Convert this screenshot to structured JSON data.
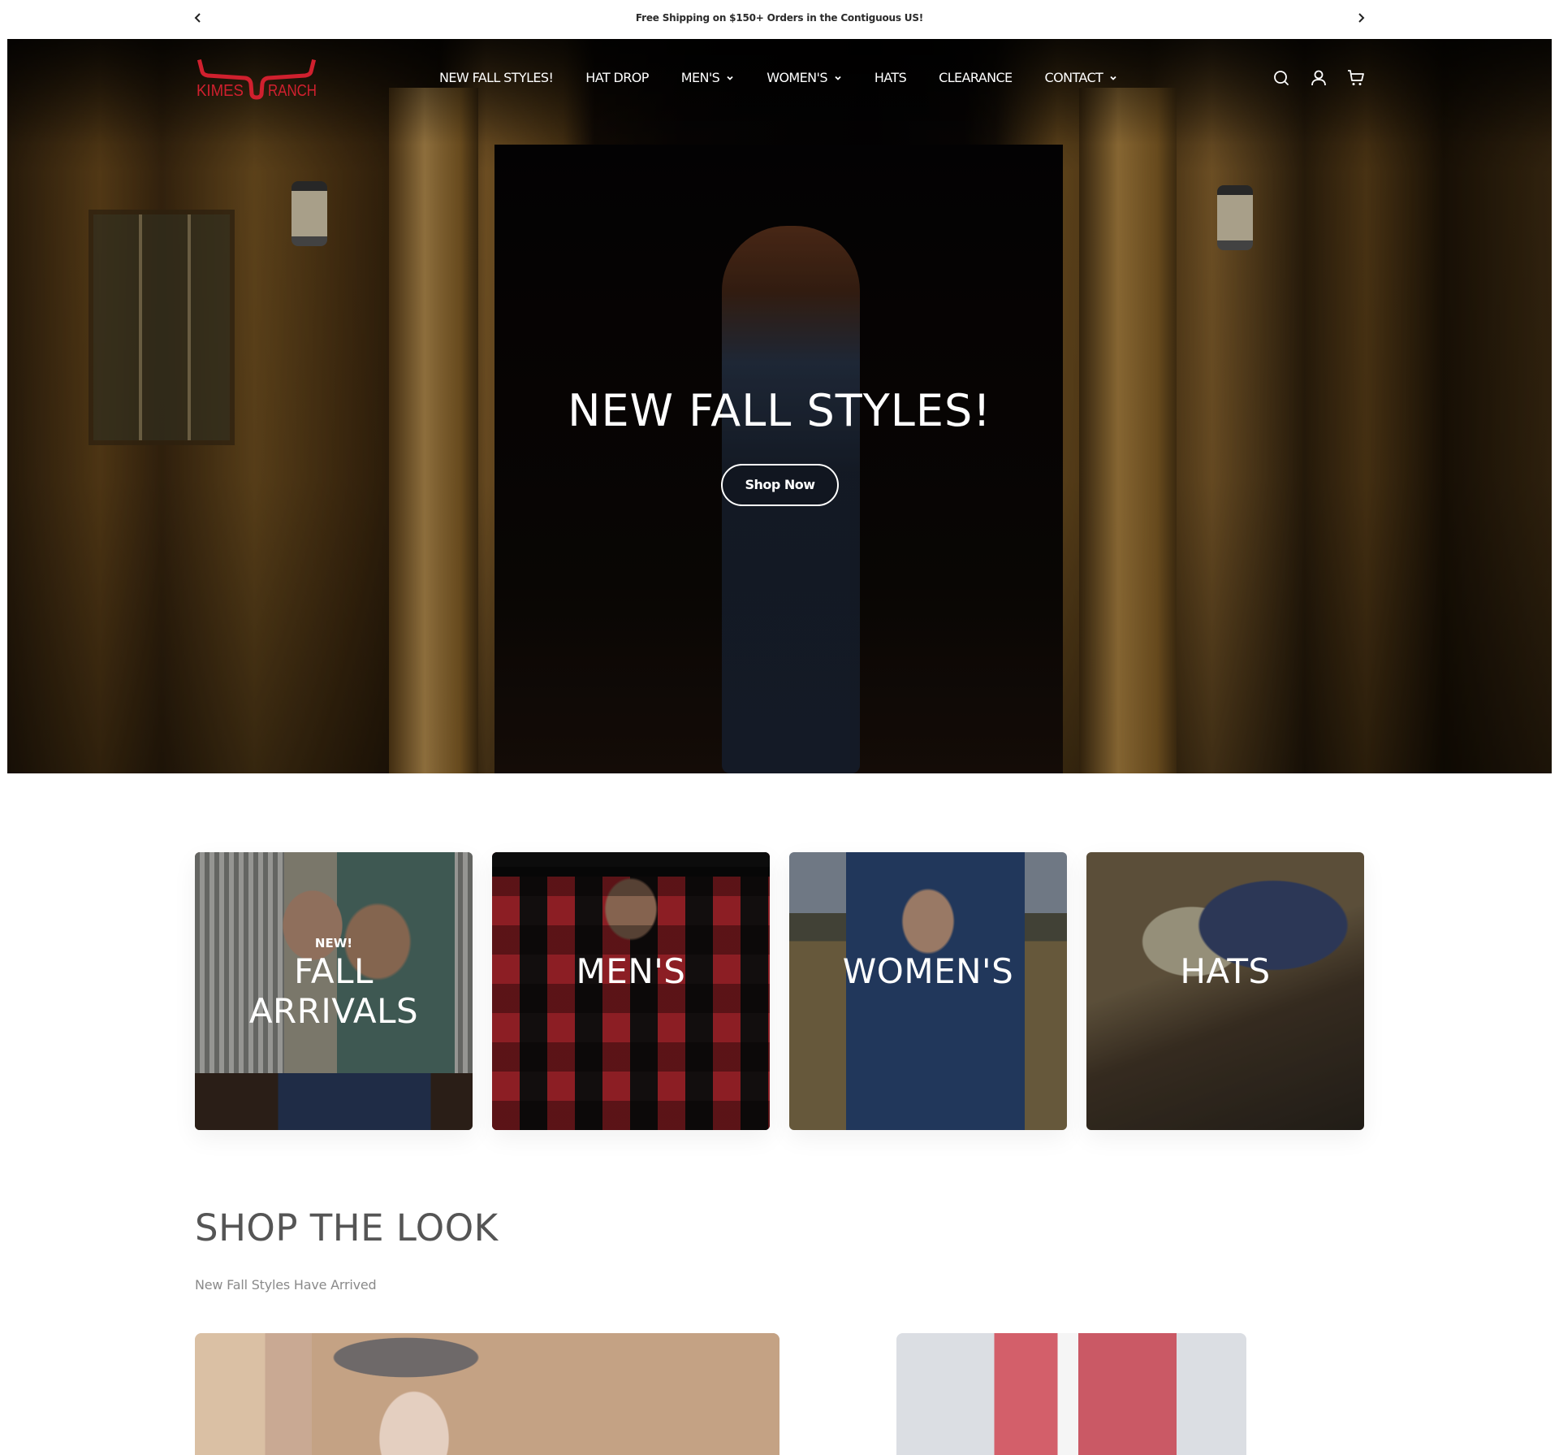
{
  "announcement": {
    "message": "Free Shipping on $150+ Orders in the Contiguous US!",
    "prev_icon": "chevron-left-icon",
    "next_icon": "chevron-right-icon"
  },
  "header": {
    "logo_text_left": "KIMES",
    "logo_text_right": "RANCH",
    "brand_color": "#d0202e",
    "nav": [
      {
        "label": "NEW FALL STYLES!",
        "has_dropdown": false
      },
      {
        "label": "HAT DROP",
        "has_dropdown": false
      },
      {
        "label": "MEN'S",
        "has_dropdown": true
      },
      {
        "label": "WOMEN'S",
        "has_dropdown": true
      },
      {
        "label": "HATS",
        "has_dropdown": false
      },
      {
        "label": "CLEARANCE",
        "has_dropdown": false
      },
      {
        "label": "CONTACT",
        "has_dropdown": true
      }
    ],
    "icons": [
      "search-icon",
      "account-icon",
      "cart-icon"
    ]
  },
  "hero": {
    "title": "NEW FALL STYLES!",
    "button_label": "Shop Now"
  },
  "categories": [
    {
      "eyebrow": "NEW!",
      "label_line1": "FALL",
      "label_line2": "ARRIVALS"
    },
    {
      "label": "MEN'S"
    },
    {
      "label": "WOMEN'S"
    },
    {
      "label": "HATS"
    }
  ],
  "shop_the_look": {
    "title": "SHOP THE LOOK",
    "subtitle": "New Fall Styles Have Arrived"
  }
}
